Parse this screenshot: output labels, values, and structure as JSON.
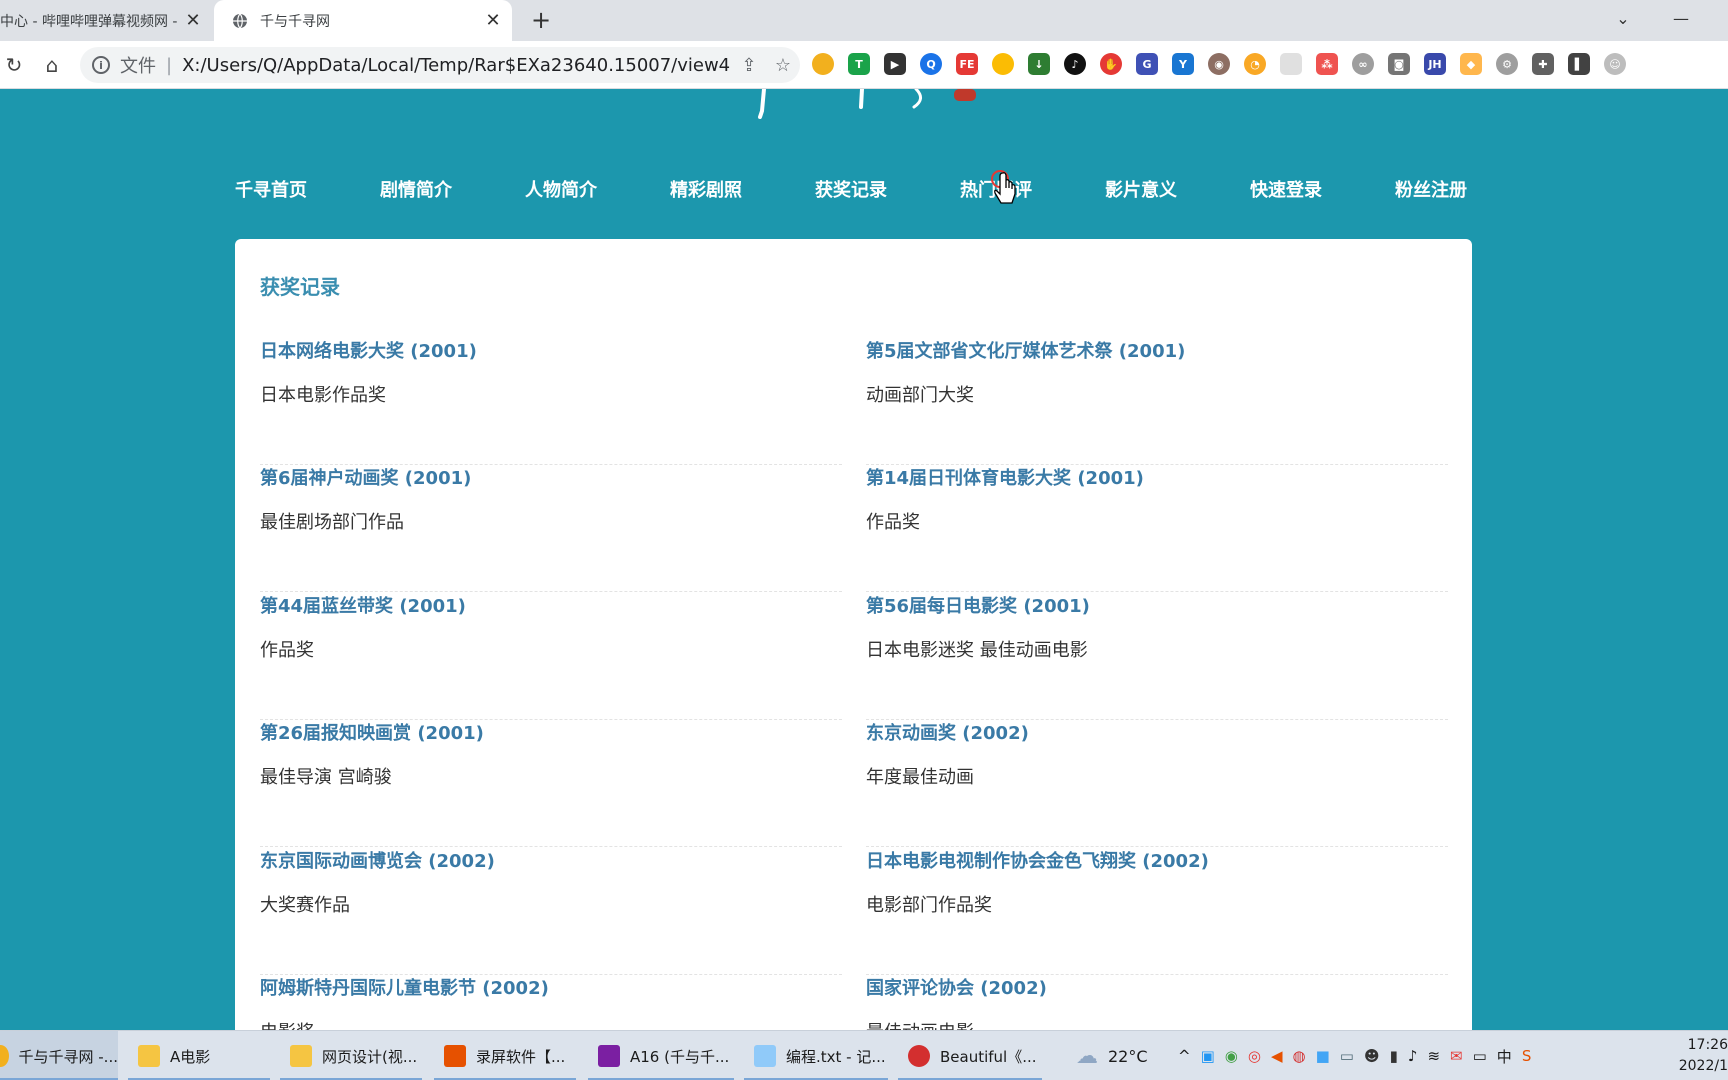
{
  "browser": {
    "tabs": [
      {
        "title": "中心 - 哔哩哔哩弹幕视频网 -",
        "active": false
      },
      {
        "title": "千与千寻网",
        "active": true
      }
    ],
    "address": {
      "scheme": "文件",
      "separator": "|",
      "url": "X:/Users/Q/AppData/Local/Temp/Rar$EXa23640.15007/view4...."
    }
  },
  "nav": {
    "items": [
      "千寻首页",
      "剧情简介",
      "人物简介",
      "精彩剧照",
      "获奖记录",
      "热门影评",
      "影片意义",
      "快速登录",
      "粉丝注册"
    ]
  },
  "awards": {
    "title": "获奖记录",
    "left": [
      {
        "name": "日本网络电影大奖 (2001)",
        "category": "日本电影作品奖"
      },
      {
        "name": "第6届神户动画奖 (2001)",
        "category": "最佳剧场部门作品"
      },
      {
        "name": "第44届蓝丝带奖 (2001)",
        "category": "作品奖"
      },
      {
        "name": "第26届报知映画赏 (2001)",
        "category": "最佳导演 宫崎骏"
      },
      {
        "name": "东京国际动画博览会 (2002)",
        "category": "大奖赛作品"
      },
      {
        "name": "阿姆斯特丹国际儿童电影节 (2002)",
        "category": "电影奖"
      }
    ],
    "right": [
      {
        "name": "第5届文部省文化厅媒体艺术祭 (2001)",
        "category": "动画部门大奖"
      },
      {
        "name": "第14届日刊体育电影大奖 (2001)",
        "category": "作品奖"
      },
      {
        "name": "第56届每日电影奖 (2001)",
        "category": "日本电影迷奖 最佳动画电影"
      },
      {
        "name": "东京动画奖 (2002)",
        "category": "年度最佳动画"
      },
      {
        "name": "日本电影电视制作协会金色飞翔奖 (2002)",
        "category": "电影部门作品奖"
      },
      {
        "name": "国家评论协会 (2002)",
        "category": "最佳动画电影"
      }
    ]
  },
  "taskbar": {
    "tasks": [
      {
        "label": "千与千寻网 -...",
        "icon": "chrome-icon"
      },
      {
        "label": "A电影",
        "icon": "folder-icon"
      },
      {
        "label": "网页设计(视...",
        "icon": "folder-icon"
      },
      {
        "label": "录屏软件【...",
        "icon": "recorder-icon"
      },
      {
        "label": "A16 (千与千...",
        "icon": "winrar-icon"
      },
      {
        "label": "编程.txt - 记...",
        "icon": "notepad-icon"
      },
      {
        "label": "Beautiful《...",
        "icon": "netease-music-icon"
      }
    ],
    "weather": "22°C",
    "ime": "中",
    "time": "17:26",
    "date": "2022/1"
  },
  "colors": {
    "page_background": "#1c97ad",
    "award_title": "#3a7aa6",
    "card_title": "#3a8eb0"
  }
}
